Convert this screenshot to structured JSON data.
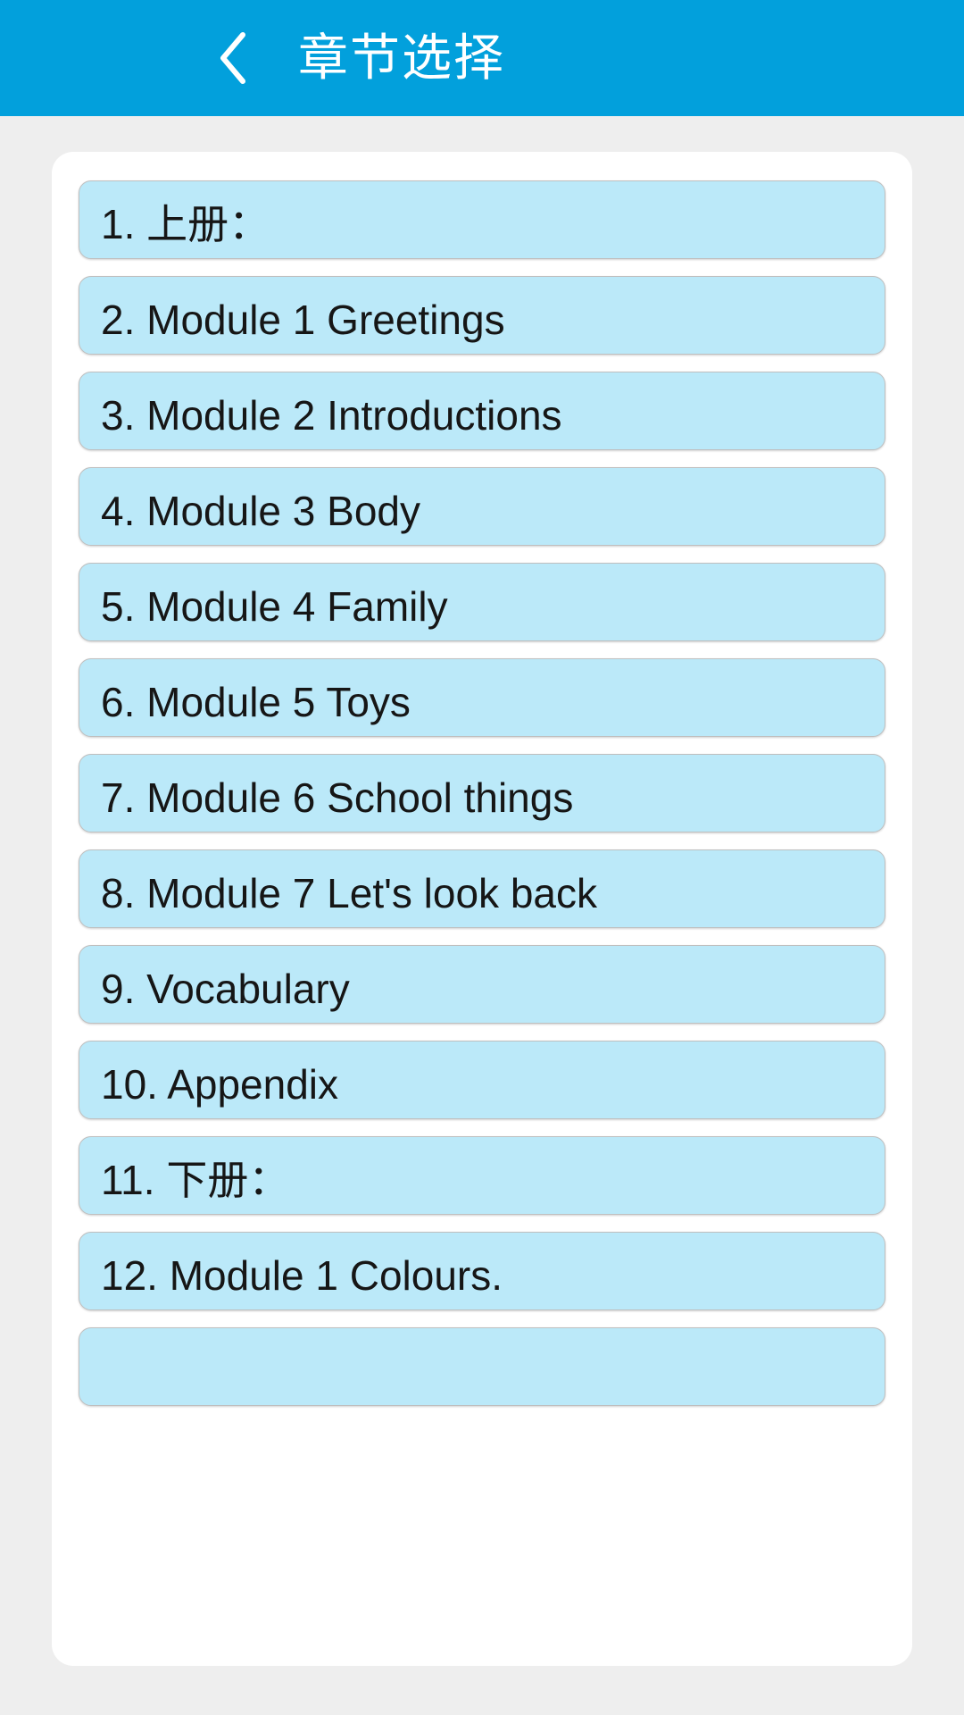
{
  "header": {
    "title": "章节选择",
    "back_icon": "chevron-left-icon",
    "background_color": "#02A0DC",
    "text_color": "#FFFFFF"
  },
  "colors": {
    "page_background": "#EEEEEE",
    "card_background": "#FFFFFF",
    "item_fill": "#BBE9F9",
    "item_border": "#BFBFBF",
    "item_text": "#161616"
  },
  "chapter_list": {
    "items": [
      {
        "label": "1. 上册："
      },
      {
        "label": "2. Module 1 Greetings"
      },
      {
        "label": "3. Module 2 Introductions"
      },
      {
        "label": "4. Module 3 Body"
      },
      {
        "label": "5. Module 4 Family"
      },
      {
        "label": "6. Module 5 Toys"
      },
      {
        "label": "7. Module 6 School things"
      },
      {
        "label": "8. Module 7 Let's look back"
      },
      {
        "label": "9. Vocabulary"
      },
      {
        "label": "10. Appendix"
      },
      {
        "label": "11. 下册："
      },
      {
        "label": "12. Module 1 Colours."
      },
      {
        "label": ""
      }
    ]
  }
}
